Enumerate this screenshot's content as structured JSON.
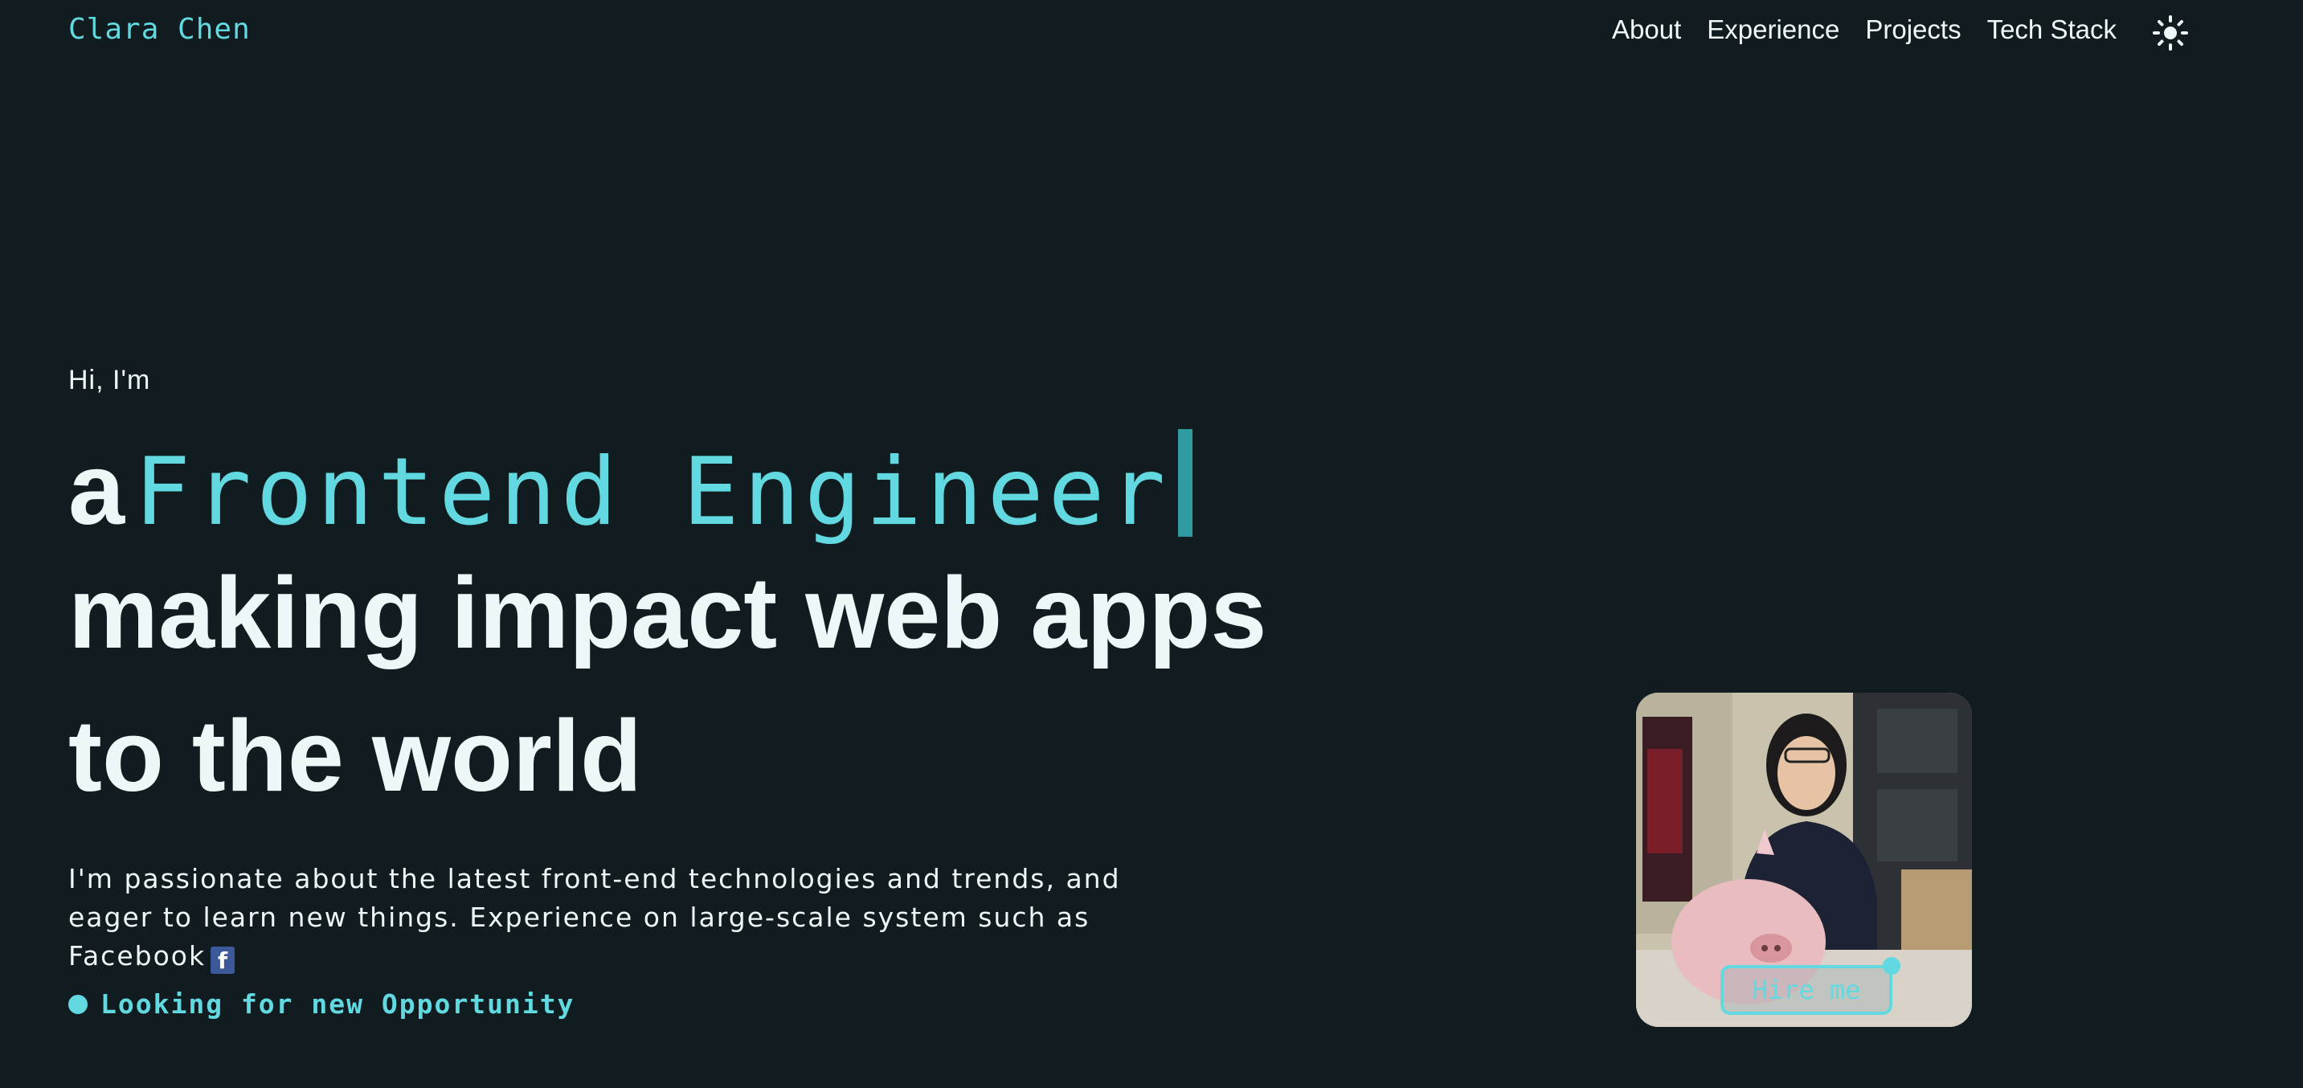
{
  "header": {
    "logo": "Clara Chen",
    "nav": [
      "About",
      "Experience",
      "Projects",
      "Tech Stack"
    ],
    "theme_toggle_icon": "sun-icon"
  },
  "hero": {
    "greeting": "Hi, I'm",
    "article": "a",
    "role": "Frontend Engineer",
    "line2": "making impact web apps",
    "line3": "to the world",
    "intro": "I'm passionate about the latest front-end technologies and trends, and eager to learn new things. Experience on large-scale system such as Facebook",
    "facebook_icon": "facebook-icon",
    "status": "Looking for new Opportunity",
    "hire_button": "Hire me"
  },
  "colors": {
    "background": "#101c1f",
    "accent": "#62d9e0",
    "text": "#eef7f7"
  }
}
